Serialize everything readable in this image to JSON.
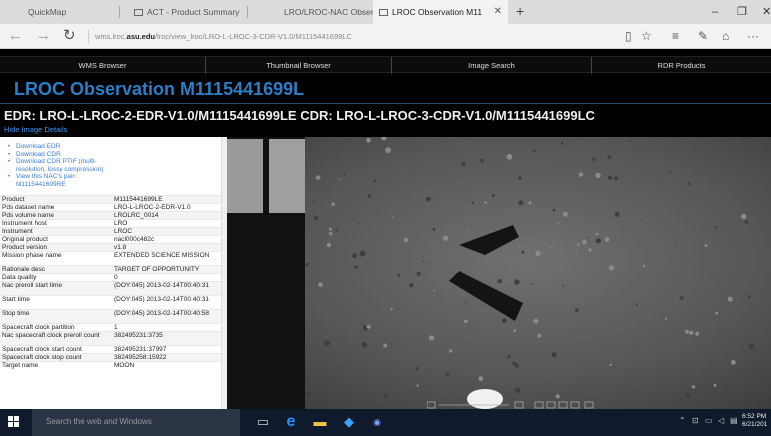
{
  "browser": {
    "tabs": [
      {
        "label": "QuickMap"
      },
      {
        "label": "ACT - Product Summary"
      },
      {
        "label": "LRO/LROC-NAC Observatio"
      },
      {
        "label": "LROC Observation M11",
        "active": true
      }
    ],
    "new_tab": "+",
    "url_prefix": "wms.lroc.",
    "url_domain": "asu.edu",
    "url_path": "/lroc/view_lroc/LRO-L-LROC-3-CDR-V1.0/M1115441699LC"
  },
  "topnav": [
    "WMS Browser",
    "Thumbnail Browser",
    "Image Search",
    "RDR Products"
  ],
  "page": {
    "title": "LROC Observation M1115441699L",
    "edr_line": "EDR: LRO-L-LROC-2-EDR-V1.0/M1115441699LE CDR: LRO-L-LROC-3-CDR-V1.0/M1115441699LC",
    "hide_link": "Hide Image Details",
    "downloads": [
      "Download EDR",
      "Download CDR",
      "Download CDR PTIF (multi-resolution, lossy compression)",
      "View this NAC's pair: M1115441699RE"
    ]
  },
  "properties": [
    {
      "k": "Product",
      "v": "M1115441699LE"
    },
    {
      "k": "Pds dataset name",
      "v": "LRO-L-LROC-2-EDR-V1.0"
    },
    {
      "k": "Pds volume name",
      "v": "LROLRC_0014"
    },
    {
      "k": "Instrument host",
      "v": "LRO"
    },
    {
      "k": "Instrument",
      "v": "LROC"
    },
    {
      "k": "Original product",
      "v": "nacl000c482c"
    },
    {
      "k": "Product version",
      "v": "v1.8"
    },
    {
      "k": "Mission phase name",
      "v": "EXTENDED SCIENCE MISSION"
    },
    {
      "k": "Rationale desc",
      "v": "TARGET OF OPPORTUNITY"
    },
    {
      "k": "Data quality",
      "v": "0"
    },
    {
      "k": "Nac preroll start time",
      "v": "(DOY:045) 2013-02-14T00:40:31"
    },
    {
      "k": "Start time",
      "v": "(DOY:045) 2013-02-14T00:40:31"
    },
    {
      "k": "Stop time",
      "v": "(DOY:045) 2013-02-14T00:40:58"
    },
    {
      "k": "Spacecraft clock partition",
      "v": "1"
    },
    {
      "k": "Nac spacecraft clock preroll count",
      "v": "382495231:3735"
    },
    {
      "k": "Spacecraft clock start count",
      "v": "382495231:37997"
    },
    {
      "k": "Spacecraft clock stop count",
      "v": "382495258:15922"
    },
    {
      "k": "Target name",
      "v": "MOON"
    }
  ],
  "taskbar": {
    "search_placeholder": "Search the web and Windows",
    "time": "6:52 PM",
    "date": "6/21/201"
  },
  "colors": {
    "title_blue": "#2a7fc8",
    "link_blue": "#3b7de0",
    "taskbar": "#0f1a2c"
  }
}
